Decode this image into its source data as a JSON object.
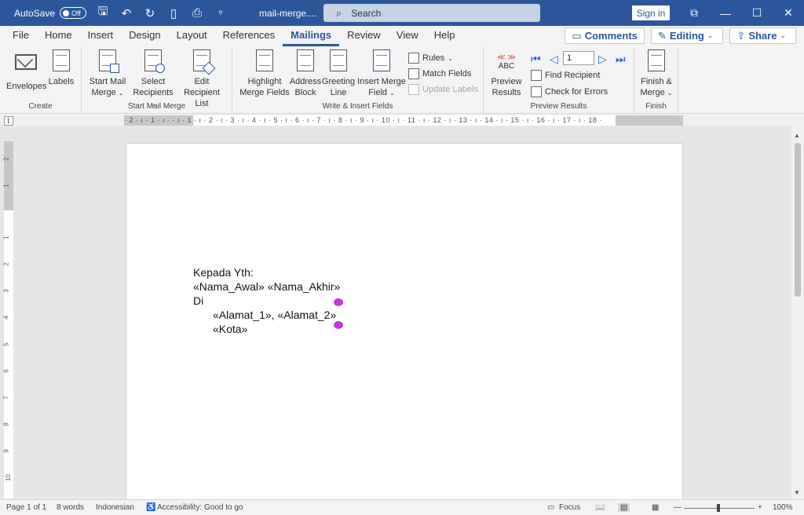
{
  "titlebar": {
    "autosave_label": "AutoSave",
    "autosave_state": "Off",
    "doc_title": "mail-merge....",
    "search_placeholder": "Search",
    "signin_label": "Sign in"
  },
  "tabs": [
    "File",
    "Home",
    "Insert",
    "Design",
    "Layout",
    "References",
    "Mailings",
    "Review",
    "View",
    "Help"
  ],
  "active_tab": "Mailings",
  "right_buttons": {
    "comments": "Comments",
    "editing": "Editing",
    "share": "Share"
  },
  "ribbon": {
    "create": {
      "label": "Create",
      "envelopes": "Envelopes",
      "labels": "Labels"
    },
    "start_mail_merge": {
      "label": "Start Mail Merge",
      "start_line1": "Start Mail",
      "start_line2": "Merge",
      "select_line1": "Select",
      "select_line2": "Recipients",
      "edit_line1": "Edit",
      "edit_line2": "Recipient List"
    },
    "write_insert": {
      "label": "Write & Insert Fields",
      "highlight_line1": "Highlight",
      "highlight_line2": "Merge Fields",
      "address_line1": "Address",
      "address_line2": "Block",
      "greeting_line1": "Greeting",
      "greeting_line2": "Line",
      "insert_line1": "Insert Merge",
      "insert_line2": "Field",
      "rules": "Rules",
      "match_fields": "Match Fields",
      "update_labels": "Update Labels"
    },
    "preview": {
      "label": "Preview Results",
      "abc": "ABC",
      "preview_line1": "Preview",
      "preview_line2": "Results",
      "record_value": "1",
      "find_recipient": "Find Recipient",
      "check_errors": "Check for Errors"
    },
    "finish": {
      "label": "Finish",
      "finish_line1": "Finish &",
      "finish_line2": "Merge"
    }
  },
  "ruler": {
    "h_numbers": "· 2 · ı · 1 · ı ·   · ı · 1 · ı · 2 · ı · 3 · ı · 4 · ı · 5 · ı · 6 · ı · 7 · ı · 8 · ı · 9 · ı · 10 · ı · 11 · ı · 12 · ı · 13 · ı · 14 · ı · 15 · ı · 16 · ı · 17 · ı · 18 ·",
    "v_numbers": [
      "2",
      "1",
      "1",
      "2",
      "3",
      "4",
      "5",
      "6",
      "7",
      "8",
      "9",
      "10"
    ]
  },
  "document": {
    "line1": "Kepada Yth:",
    "line2": "«Nama_Awal» «Nama_Akhir»",
    "line3": "Di",
    "line4": "«Alamat_1», «Alamat_2»",
    "line5": "«Kota»"
  },
  "status": {
    "page": "Page 1 of 1",
    "words": "8 words",
    "language": "Indonesian",
    "accessibility": "Accessibility: Good to go",
    "focus": "Focus",
    "zoom": "100%"
  },
  "colors": {
    "brand": "#2b579a",
    "merge_cursor": "#c03ad6"
  }
}
